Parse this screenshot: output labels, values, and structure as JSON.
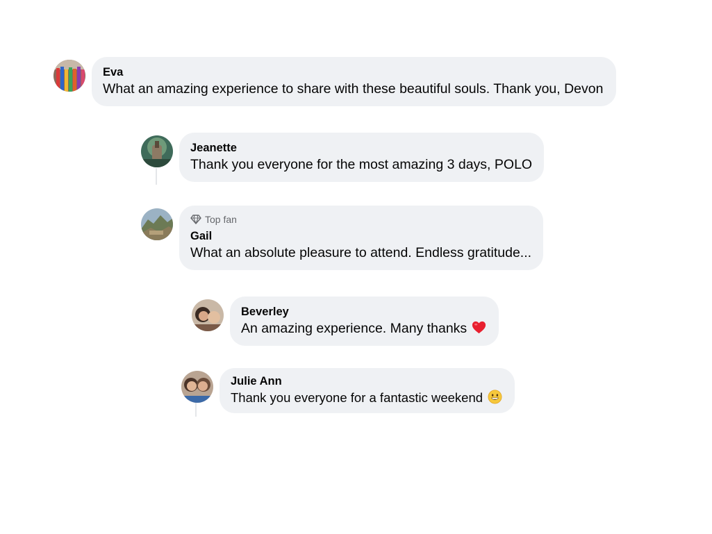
{
  "comments": [
    {
      "author": "Eva",
      "text": "What an amazing experience to share with these beautiful souls. Thank you, Devon"
    },
    {
      "author": "Jeanette",
      "text": "Thank you everyone for the most amazing 3 days, POLO"
    },
    {
      "badge": "Top fan",
      "author": "Gail",
      "text": "What an absolute pleasure to attend. Endless gratitude..."
    },
    {
      "author": "Beverley",
      "text": "An amazing experience. Many thanks",
      "emoji": "red-heart"
    },
    {
      "author": "Julie Ann",
      "text": "Thank you everyone for a fantastic weekend",
      "emoji": "grinning-face"
    }
  ],
  "colors": {
    "bubble": "#eff1f4",
    "text": "#050505",
    "secondary_text": "#65676b",
    "thread_line": "#e4e6e9"
  }
}
